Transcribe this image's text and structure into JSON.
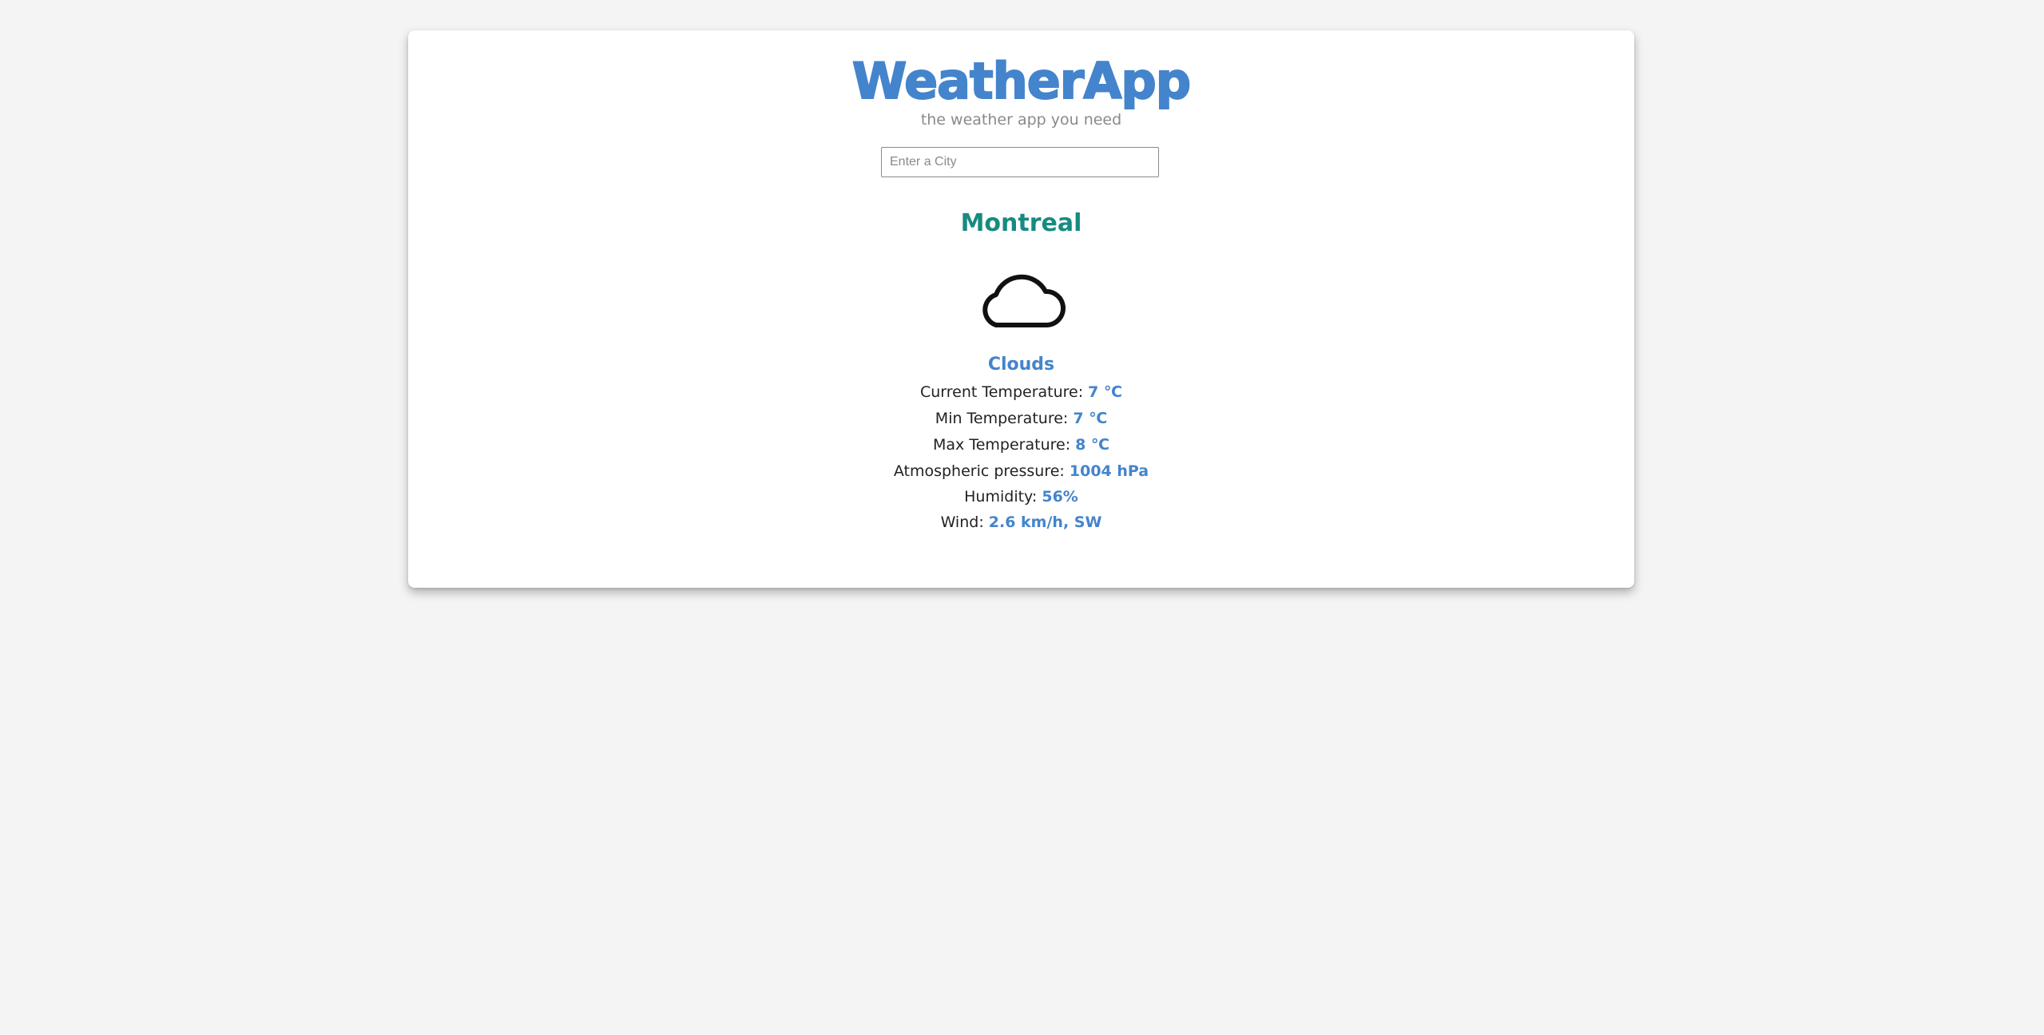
{
  "app": {
    "title": "WeatherApp",
    "tagline": "the weather app you need"
  },
  "search": {
    "placeholder": "Enter a City",
    "value": ""
  },
  "weather": {
    "city": "Montreal",
    "icon": "cloud-icon",
    "condition": "Clouds",
    "rows": [
      {
        "label": "Current Temperature: ",
        "value": "7 ℃"
      },
      {
        "label": "Min Temperature: ",
        "value": "7 ℃"
      },
      {
        "label": "Max Temperature: ",
        "value": "8 ℃"
      },
      {
        "label": "Atmospheric pressure: ",
        "value": "1004 hPa"
      },
      {
        "label": "Humidity: ",
        "value": "56%"
      },
      {
        "label": "Wind: ",
        "value": "2.6 km/h, SW"
      }
    ]
  },
  "colors": {
    "brand": "#4484cc",
    "city": "#168b80",
    "background": "#f4f4f4"
  }
}
